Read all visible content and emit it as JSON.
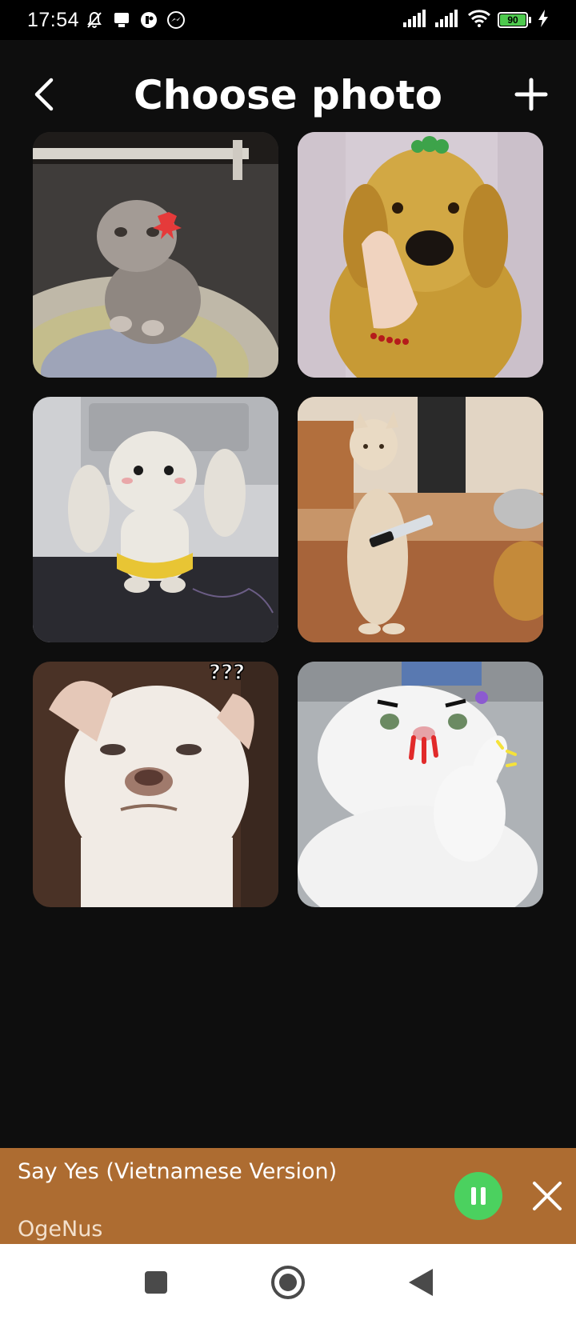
{
  "status_bar": {
    "time": "17:54",
    "battery_level": "90",
    "icons": [
      "mute-bell-icon",
      "tray-icon",
      "app-icon",
      "messenger-icon",
      "signal-icon",
      "signal-icon",
      "wifi-icon",
      "battery-icon",
      "charging-icon"
    ]
  },
  "header": {
    "title": "Choose photo",
    "back_icon": "chevron-left-icon",
    "add_icon": "plus-icon"
  },
  "photos": [
    {
      "subject": "angry kitten on rug"
    },
    {
      "subject": "golden retriever with hand on chin"
    },
    {
      "subject": "crochet bunny toy"
    },
    {
      "subject": "standing cat holding knife"
    },
    {
      "subject": "confused white dog"
    },
    {
      "subject": "white cat giving thumbs up"
    }
  ],
  "player": {
    "title": "Say Yes (Vietnamese Version)",
    "artist": "OgeNus",
    "accent_color": "#ad6c31",
    "pause_color": "#4bd15f"
  },
  "nav": {
    "items": [
      "recents-square-icon",
      "home-circle-icon",
      "back-triangle-icon"
    ]
  }
}
